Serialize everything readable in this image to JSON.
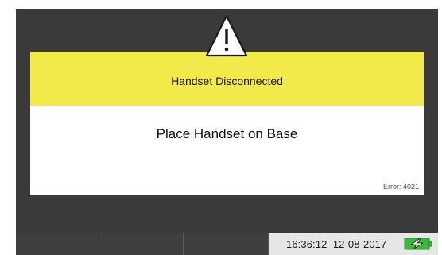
{
  "dialog": {
    "title": "Handset Disconnected",
    "message": "Place Handset on Base",
    "error_code": "Error: 4021",
    "icon": "warning-triangle-icon",
    "header_color": "#f2e94a"
  },
  "status_bar": {
    "soft_keys": [
      "",
      "",
      ""
    ],
    "datetime": "16:36:12  12-08-2017",
    "battery_icon": "battery-charging-icon",
    "battery_color": "#3cb83c"
  }
}
